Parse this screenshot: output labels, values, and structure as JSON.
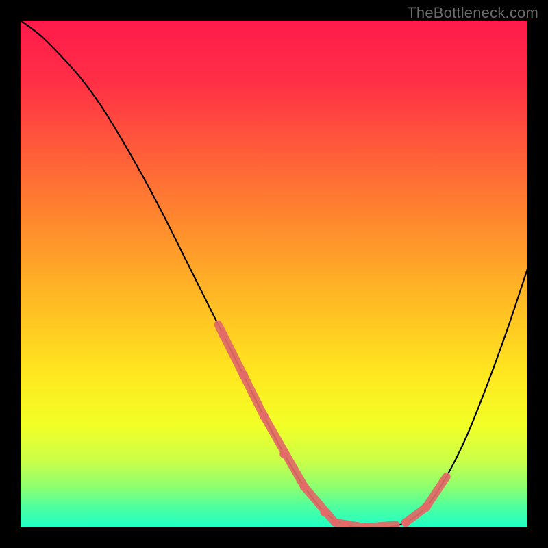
{
  "watermark": "TheBottleneck.com",
  "chart_data": {
    "type": "line",
    "title": "",
    "xlabel": "",
    "ylabel": "",
    "xlim": [
      0,
      100
    ],
    "ylim": [
      0,
      100
    ],
    "x": [
      0,
      4,
      8,
      12,
      16,
      20,
      24,
      28,
      32,
      36,
      40,
      44,
      48,
      52,
      56,
      60,
      64,
      68,
      72,
      76,
      80,
      84,
      88,
      92,
      96,
      100
    ],
    "y": [
      100,
      97,
      93,
      88.5,
      83,
      76.5,
      69.5,
      62,
      54,
      46,
      38,
      30,
      22,
      14.5,
      8,
      3,
      0.5,
      0,
      0,
      1,
      4,
      10,
      18,
      28,
      39,
      51
    ],
    "band_points": {
      "x": [
        40,
        44,
        48,
        52,
        56,
        60,
        64,
        68,
        72,
        76,
        80
      ],
      "y": [
        38,
        30,
        22,
        14.5,
        8,
        3,
        0.5,
        0,
        0,
        1,
        4
      ]
    },
    "band_segments": [
      {
        "x0": 39,
        "y0": 40,
        "x1": 48,
        "y1": 22
      },
      {
        "x0": 48,
        "y0": 22,
        "x1": 56,
        "y1": 8
      },
      {
        "x0": 56,
        "y0": 8,
        "x1": 62,
        "y1": 1
      },
      {
        "x0": 62,
        "y0": 1,
        "x1": 68,
        "y1": 0
      },
      {
        "x0": 68,
        "y0": 0,
        "x1": 74,
        "y1": 0.5
      },
      {
        "x0": 76,
        "y0": 1,
        "x1": 80,
        "y1": 4
      },
      {
        "x0": 80,
        "y0": 4,
        "x1": 84,
        "y1": 10
      }
    ],
    "gradient_stops": [
      {
        "offset": 0.0,
        "color": "#ff1a4b"
      },
      {
        "offset": 0.12,
        "color": "#ff2f46"
      },
      {
        "offset": 0.25,
        "color": "#ff5a3a"
      },
      {
        "offset": 0.4,
        "color": "#ff8a2e"
      },
      {
        "offset": 0.55,
        "color": "#ffba24"
      },
      {
        "offset": 0.7,
        "color": "#ffe81f"
      },
      {
        "offset": 0.8,
        "color": "#f1ff26"
      },
      {
        "offset": 0.87,
        "color": "#c9ff4a"
      },
      {
        "offset": 0.92,
        "color": "#8dff6f"
      },
      {
        "offset": 0.96,
        "color": "#4dffa0"
      },
      {
        "offset": 1.0,
        "color": "#1effc6"
      }
    ],
    "band_color": "#e26a68",
    "curve_color": "#000000"
  }
}
